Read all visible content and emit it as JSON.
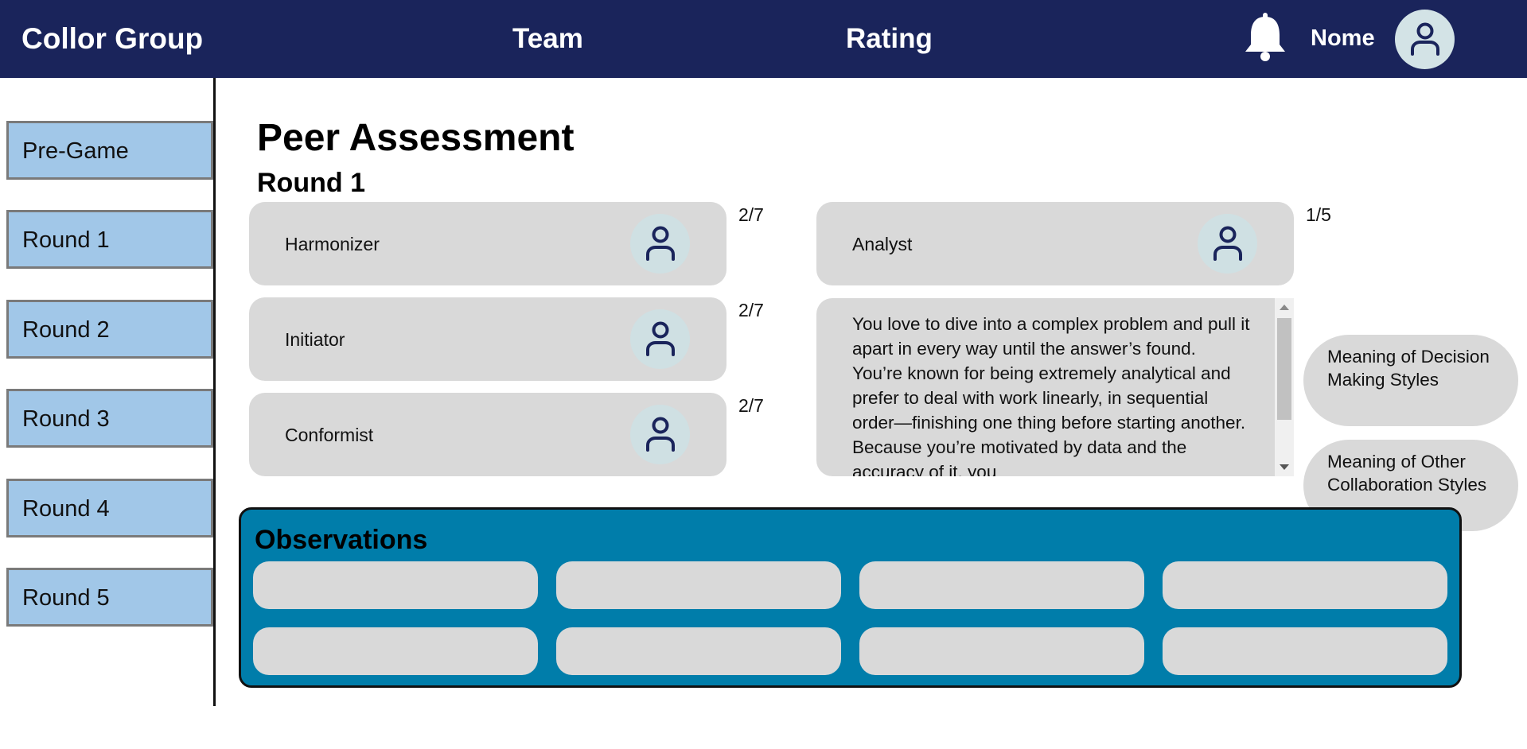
{
  "header": {
    "brand": "Collor Group",
    "nav": {
      "team": "Team",
      "rating": "Rating"
    },
    "notifications_icon": "bell-icon",
    "user_name": "Nome",
    "avatar_icon": "user-icon"
  },
  "sidebar": {
    "items": [
      {
        "label": "Pre-Game"
      },
      {
        "label": "Round 1"
      },
      {
        "label": "Round 2"
      },
      {
        "label": "Round 3"
      },
      {
        "label": "Round 4"
      },
      {
        "label": "Round 5"
      }
    ]
  },
  "main": {
    "title": "Peer Assessment",
    "round_title": "Round 1",
    "styles": [
      {
        "label": "Harmonizer",
        "count": "2/7",
        "icon": "user-icon"
      },
      {
        "label": "Initiator",
        "count": "2/7",
        "icon": "user-icon"
      },
      {
        "label": "Conformist",
        "count": "2/7",
        "icon": "user-icon"
      },
      {
        "label": "Analyst",
        "count": "1/5",
        "icon": "user-icon"
      }
    ],
    "description": "You love to dive into a complex problem and pull it apart in every way until the answer’s found. You’re known for being extremely analytical and prefer to deal with work linearly, in sequential order—finishing one thing before starting another. Because you’re motivated by data and the accuracy of it, you",
    "links": {
      "decision_styles": "Meaning of Decision Making Styles",
      "collaboration_styles": "Meaning of Other Collaboration Styles"
    }
  },
  "observations": {
    "title": "Observations",
    "fields": [
      "",
      "",
      "",
      "",
      "",
      "",
      "",
      ""
    ]
  },
  "colors": {
    "header_bg": "#1a245b",
    "sidebar_button": "#a1c7e8",
    "card_bg": "#d9d9d9",
    "avatar_bg": "#d3e3e6",
    "observations_bg": "#007daa",
    "icon_stroke": "#1a245b"
  }
}
